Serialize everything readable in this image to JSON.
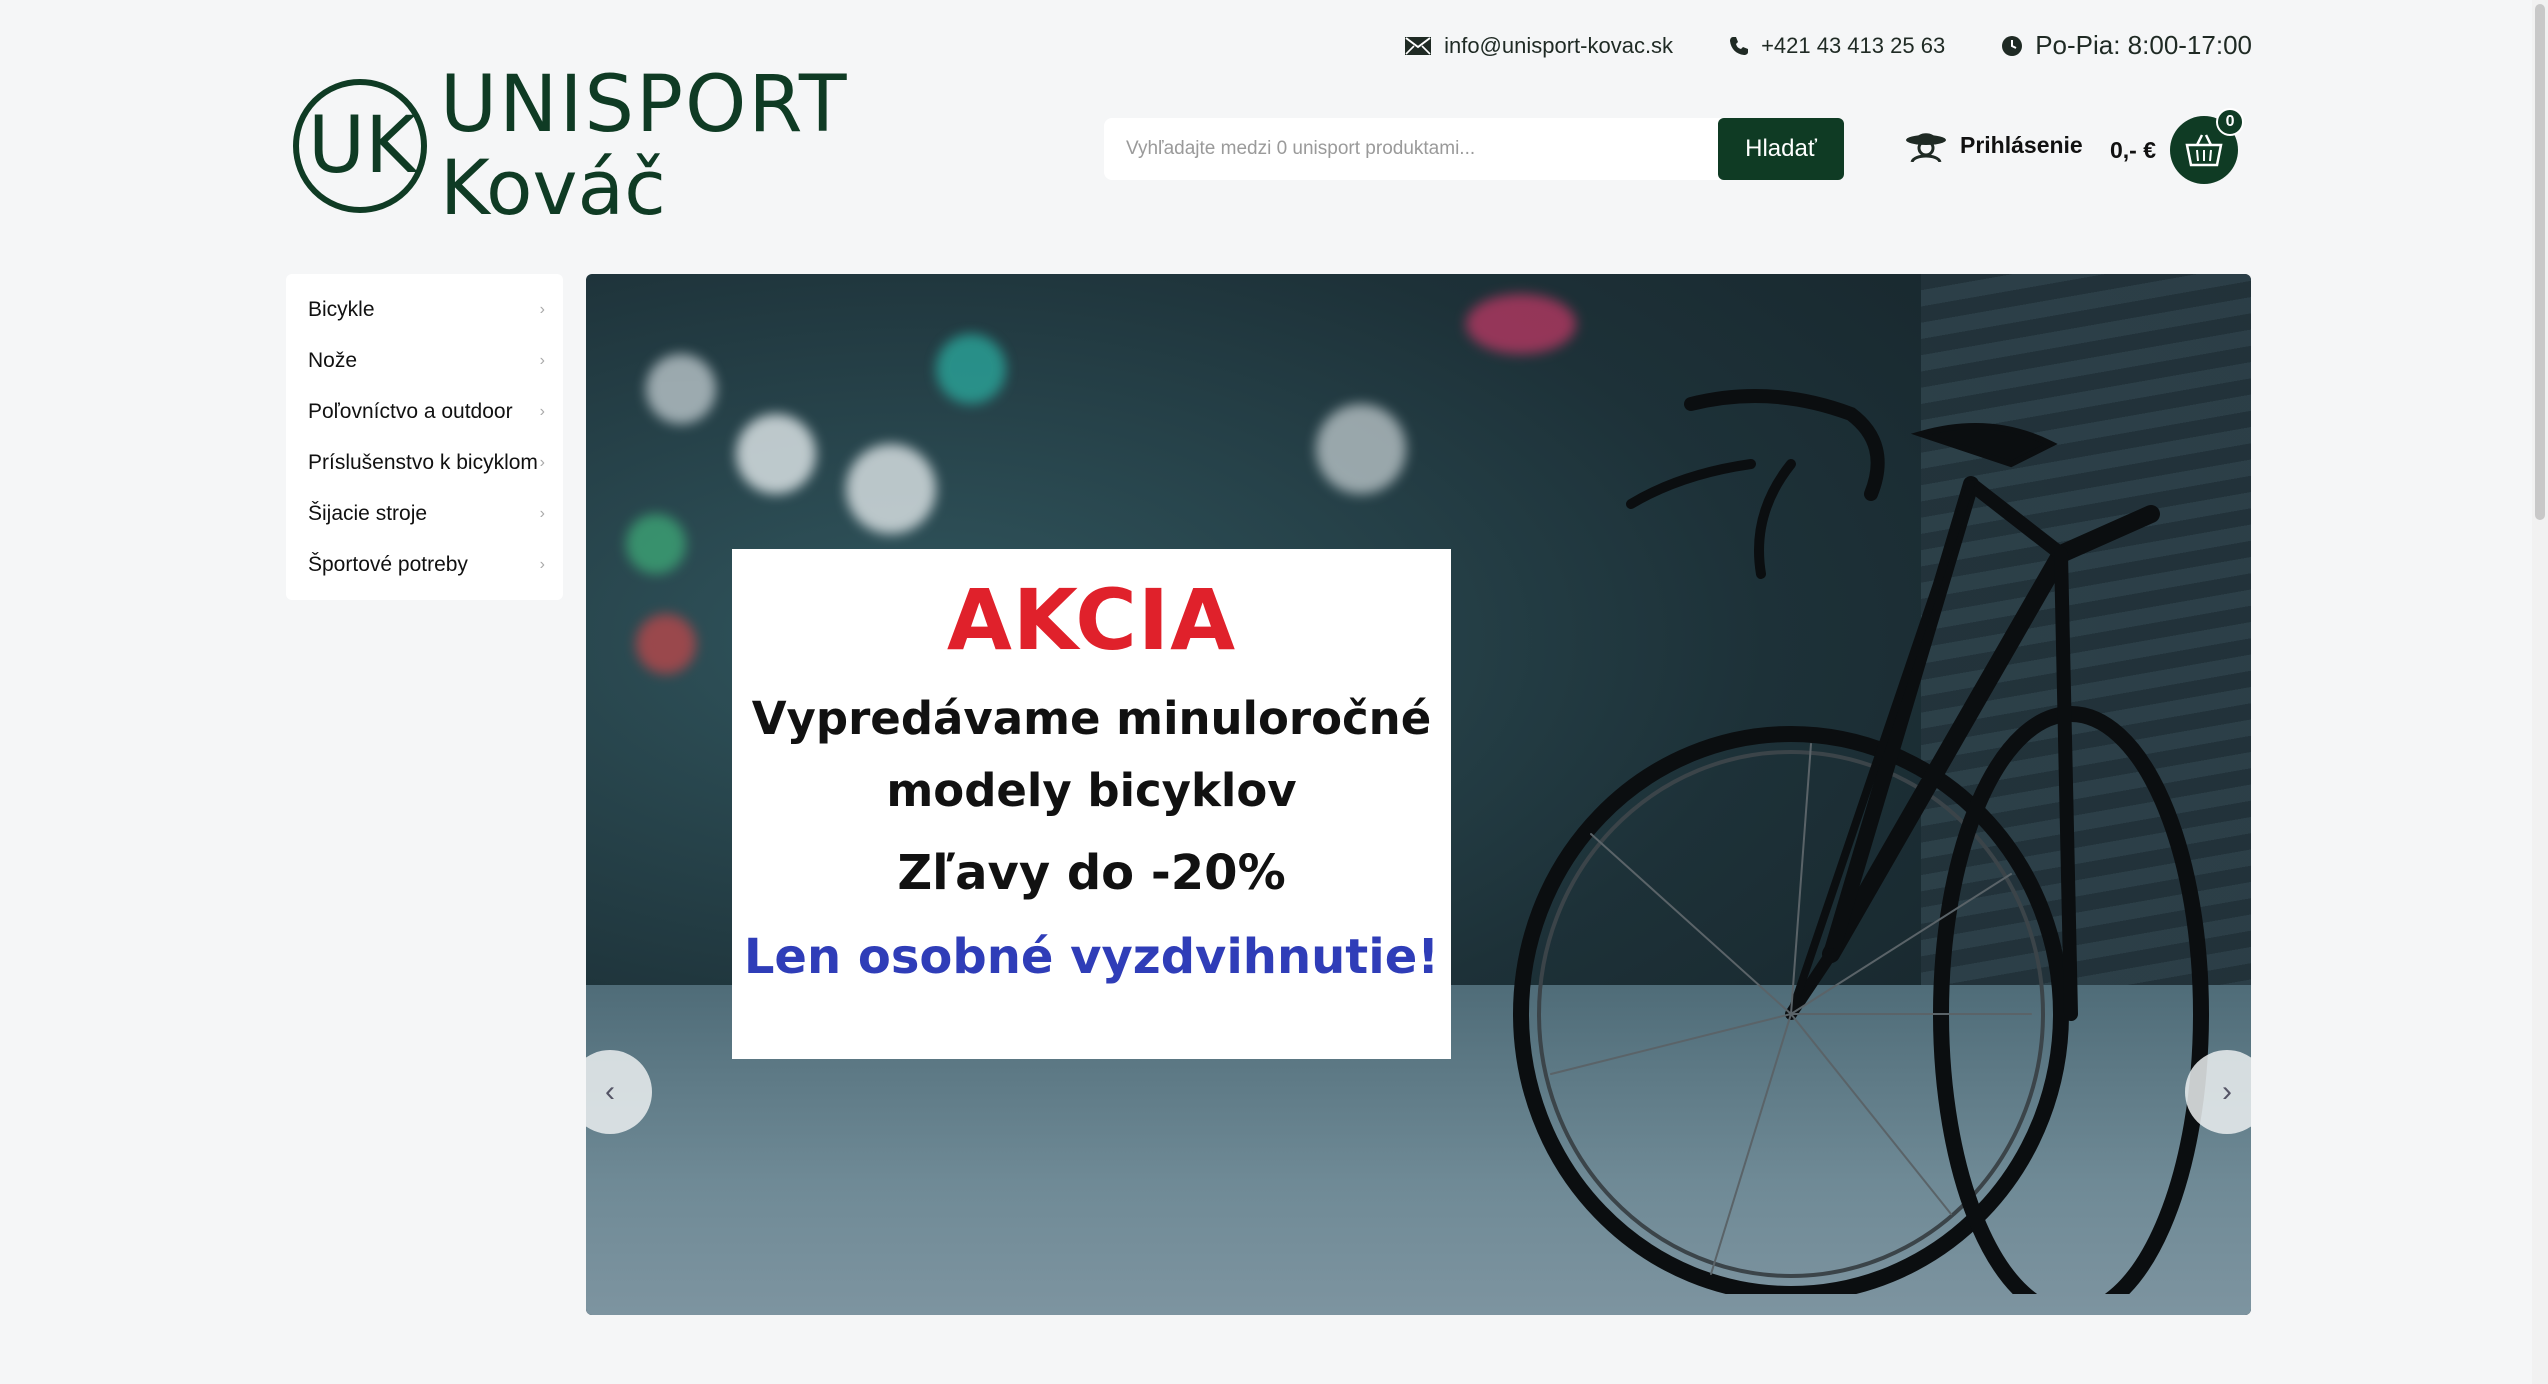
{
  "header": {
    "email": "info@unisport-kovac.sk",
    "phone": "+421 43 413 25 63",
    "hours": "Po-Pia: 8:00-17:00",
    "logo": {
      "monogram": "UK",
      "line1": "UNISPORT",
      "line2": "Kováč"
    },
    "search": {
      "placeholder": "Vyhľadajte medzi 0 unisport produktami...",
      "button_label": "Hladať"
    },
    "login_label": "Prihlásenie",
    "cart": {
      "price": "0,- €",
      "count": "0"
    }
  },
  "sidebar": {
    "items": [
      {
        "label": "Bicykle"
      },
      {
        "label": "Nože"
      },
      {
        "label": "Poľovníctvo a outdoor"
      },
      {
        "label": "Príslušenstvo k bicyklom"
      },
      {
        "label": "Šijacie stroje"
      },
      {
        "label": "Športové potreby"
      }
    ]
  },
  "hero": {
    "promo": {
      "title": "AKCIA",
      "line1": "Vypredávame minuloročné",
      "line2": "modely bicyklov",
      "line3": "Zľavy do -20%",
      "line4": "Len osobné vyzdvihnutie!"
    }
  },
  "colors": {
    "brand": "#0f3b24",
    "promo_red": "#e0212b",
    "promo_blue": "#2f3db8",
    "page_bg": "#f5f6f7"
  },
  "icons": [
    "envelope-icon",
    "phone-icon",
    "clock-icon",
    "user-hat-icon",
    "basket-icon",
    "chevron-right-icon",
    "chevron-left-icon"
  ]
}
